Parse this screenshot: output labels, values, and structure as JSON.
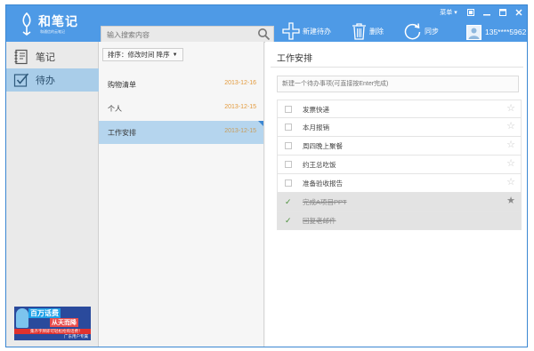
{
  "app": {
    "logo_text": "和笔记",
    "logo_sub": "和通信的云笔记",
    "menu_label": "菜单",
    "search_placeholder": "输入搜索内容"
  },
  "toolbar": {
    "new_label": "新建待办",
    "delete_label": "删除",
    "sync_label": "同步",
    "user_name": "135****5962"
  },
  "sidebar": {
    "items": [
      {
        "label": "笔记",
        "icon": "notebook-icon",
        "selected": false
      },
      {
        "label": "待办",
        "icon": "checklist-icon",
        "selected": true
      }
    ],
    "ad": {
      "title": "百万话费",
      "subtitle": "从天而降",
      "line": "集齐字牌即可轻松抢购话费！",
      "footer": "广东用户专属"
    }
  },
  "list": {
    "sort_label": "排序：修改时间  降序",
    "items": [
      {
        "name": "购物清单",
        "date": "2013-12-16",
        "selected": false
      },
      {
        "name": "个人",
        "date": "2013-12-15",
        "selected": false
      },
      {
        "name": "工作安排",
        "date": "2013-12-15",
        "selected": true
      }
    ]
  },
  "main": {
    "title": "工作安排",
    "new_todo_placeholder": "新建一个待办事项(可直接按Enter完成)",
    "todos": [
      {
        "text": "发票快递",
        "done": false,
        "starred": false
      },
      {
        "text": "本月报销",
        "done": false,
        "starred": false
      },
      {
        "text": "周四晚上聚餐",
        "done": false,
        "starred": false
      },
      {
        "text": "约王总吃饭",
        "done": false,
        "starred": false
      },
      {
        "text": "准备验收报告",
        "done": false,
        "starred": false
      },
      {
        "text": "完成A项目PPT",
        "done": true,
        "starred": true
      },
      {
        "text": "回复老邮件",
        "done": true,
        "starred": false
      }
    ]
  },
  "colors": {
    "header_blue": "#4e9ae6",
    "selection_blue": "#b5d5ee",
    "date_orange": "#e39a3c"
  }
}
